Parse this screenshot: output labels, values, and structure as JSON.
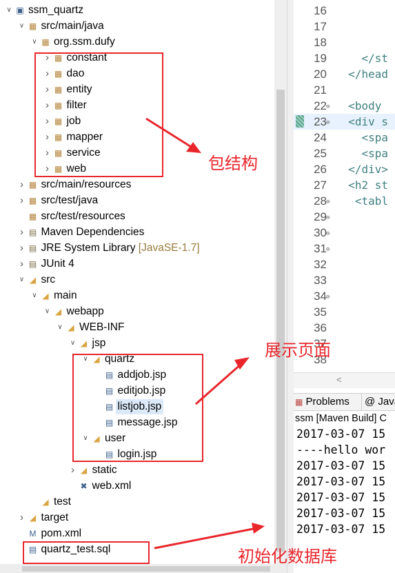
{
  "explorer": {
    "rows": [
      {
        "label": "ssm_quartz",
        "expanded": true,
        "depth": 0,
        "icon": "project-icon"
      },
      {
        "label": "src/main/java",
        "expanded": true,
        "depth": 1,
        "icon": "source-folder-icon"
      },
      {
        "label": "org.ssm.dufy",
        "expanded": true,
        "depth": 2,
        "icon": "package-icon"
      },
      {
        "label": "constant",
        "expanded": false,
        "depth": 3,
        "icon": "package-icon"
      },
      {
        "label": "dao",
        "expanded": false,
        "depth": 3,
        "icon": "package-icon"
      },
      {
        "label": "entity",
        "expanded": false,
        "depth": 3,
        "icon": "package-icon"
      },
      {
        "label": "filter",
        "expanded": false,
        "depth": 3,
        "icon": "package-icon"
      },
      {
        "label": "job",
        "expanded": false,
        "depth": 3,
        "icon": "package-icon"
      },
      {
        "label": "mapper",
        "expanded": false,
        "depth": 3,
        "icon": "package-icon"
      },
      {
        "label": "service",
        "expanded": false,
        "depth": 3,
        "icon": "package-icon"
      },
      {
        "label": "web",
        "expanded": false,
        "depth": 3,
        "icon": "package-icon"
      },
      {
        "label": "src/main/resources",
        "expanded": false,
        "depth": 1,
        "icon": "source-folder-icon"
      },
      {
        "label": "src/test/java",
        "expanded": false,
        "depth": 1,
        "icon": "source-folder-icon"
      },
      {
        "label": "src/test/resources",
        "expanded": null,
        "depth": 1,
        "icon": "source-folder-icon"
      },
      {
        "label": "Maven Dependencies",
        "expanded": false,
        "depth": 1,
        "icon": "library-icon"
      },
      {
        "label": "JRE System Library",
        "decoration": "[JavaSE-1.7]",
        "expanded": false,
        "depth": 1,
        "icon": "library-icon"
      },
      {
        "label": "JUnit 4",
        "expanded": false,
        "depth": 1,
        "icon": "library-icon"
      },
      {
        "label": "src",
        "expanded": true,
        "depth": 1,
        "icon": "folder-icon"
      },
      {
        "label": "main",
        "expanded": true,
        "depth": 2,
        "icon": "folder-icon"
      },
      {
        "label": "webapp",
        "expanded": true,
        "depth": 3,
        "icon": "folder-icon"
      },
      {
        "label": "WEB-INF",
        "expanded": true,
        "depth": 4,
        "icon": "folder-icon"
      },
      {
        "label": "jsp",
        "expanded": true,
        "depth": 5,
        "icon": "folder-icon"
      },
      {
        "label": "quartz",
        "expanded": true,
        "depth": 6,
        "icon": "folder-icon"
      },
      {
        "label": "addjob.jsp",
        "expanded": null,
        "depth": 7,
        "icon": "file-icon"
      },
      {
        "label": "editjob.jsp",
        "expanded": null,
        "depth": 7,
        "icon": "file-icon"
      },
      {
        "label": "listjob.jsp",
        "expanded": null,
        "depth": 7,
        "icon": "file-icon",
        "selected": true
      },
      {
        "label": "message.jsp",
        "expanded": null,
        "depth": 7,
        "icon": "file-icon"
      },
      {
        "label": "user",
        "expanded": true,
        "depth": 6,
        "icon": "folder-icon"
      },
      {
        "label": "login.jsp",
        "expanded": null,
        "depth": 7,
        "icon": "file-icon"
      },
      {
        "label": "static",
        "expanded": false,
        "depth": 5,
        "icon": "folder-icon"
      },
      {
        "label": "web.xml",
        "expanded": null,
        "depth": 5,
        "icon": "xml-icon"
      },
      {
        "label": "test",
        "expanded": null,
        "depth": 2,
        "icon": "folder-icon"
      },
      {
        "label": "target",
        "expanded": false,
        "depth": 1,
        "icon": "folder-icon"
      },
      {
        "label": "pom.xml",
        "expanded": null,
        "depth": 1,
        "icon": "maven-icon"
      },
      {
        "label": "quartz_test.sql",
        "expanded": null,
        "depth": 1,
        "icon": "sql-file-icon"
      }
    ]
  },
  "editor": {
    "lines": [
      {
        "num": "16",
        "code": "",
        "fold": false
      },
      {
        "num": "17",
        "code": "",
        "fold": false
      },
      {
        "num": "18",
        "code": "",
        "fold": false
      },
      {
        "num": "19",
        "code": "    </st",
        "fold": false
      },
      {
        "num": "20",
        "code": "  </head",
        "fold": false
      },
      {
        "num": "21",
        "code": "",
        "fold": false
      },
      {
        "num": "22",
        "code": "  <body",
        "fold": true
      },
      {
        "num": "23",
        "code": "  <div s",
        "fold": true,
        "highlight": true
      },
      {
        "num": "24",
        "code": "    <spa",
        "fold": false
      },
      {
        "num": "25",
        "code": "    <spa",
        "fold": false
      },
      {
        "num": "26",
        "code": "  </div>",
        "fold": false
      },
      {
        "num": "27",
        "code": "  <h2 st",
        "fold": false
      },
      {
        "num": "28",
        "code": "   <tabl",
        "fold": true
      },
      {
        "num": "29",
        "code": "",
        "fold": true
      },
      {
        "num": "30",
        "code": "",
        "fold": true
      },
      {
        "num": "31",
        "code": "",
        "fold": true
      },
      {
        "num": "32",
        "code": "",
        "fold": false
      },
      {
        "num": "33",
        "code": "",
        "fold": false
      },
      {
        "num": "34",
        "code": "",
        "fold": true
      },
      {
        "num": "35",
        "code": "",
        "fold": false
      },
      {
        "num": "36",
        "code": "",
        "fold": false
      },
      {
        "num": "37",
        "code": "",
        "fold": false
      },
      {
        "num": "38",
        "code": "",
        "fold": false
      }
    ]
  },
  "console": {
    "tabs": [
      {
        "label": "Problems",
        "icon": "problems-icon"
      },
      {
        "label": "Java",
        "icon": "javadoc-icon"
      }
    ],
    "title": "ssm [Maven Build] C",
    "lines": [
      "2017-03-07 15",
      "----hello wor",
      "2017-03-07 15",
      "2017-03-07 15",
      "2017-03-07 15",
      "2017-03-07 15",
      "2017-03-07 15"
    ]
  },
  "annotations": {
    "package_structure": "包结构",
    "display_pages": "展示页面",
    "init_database": "初始化数据库"
  },
  "colors": {
    "annotation_red": "#e8262c",
    "selection": "#dbe9f8",
    "line_highlight": "#e8f2fe"
  }
}
